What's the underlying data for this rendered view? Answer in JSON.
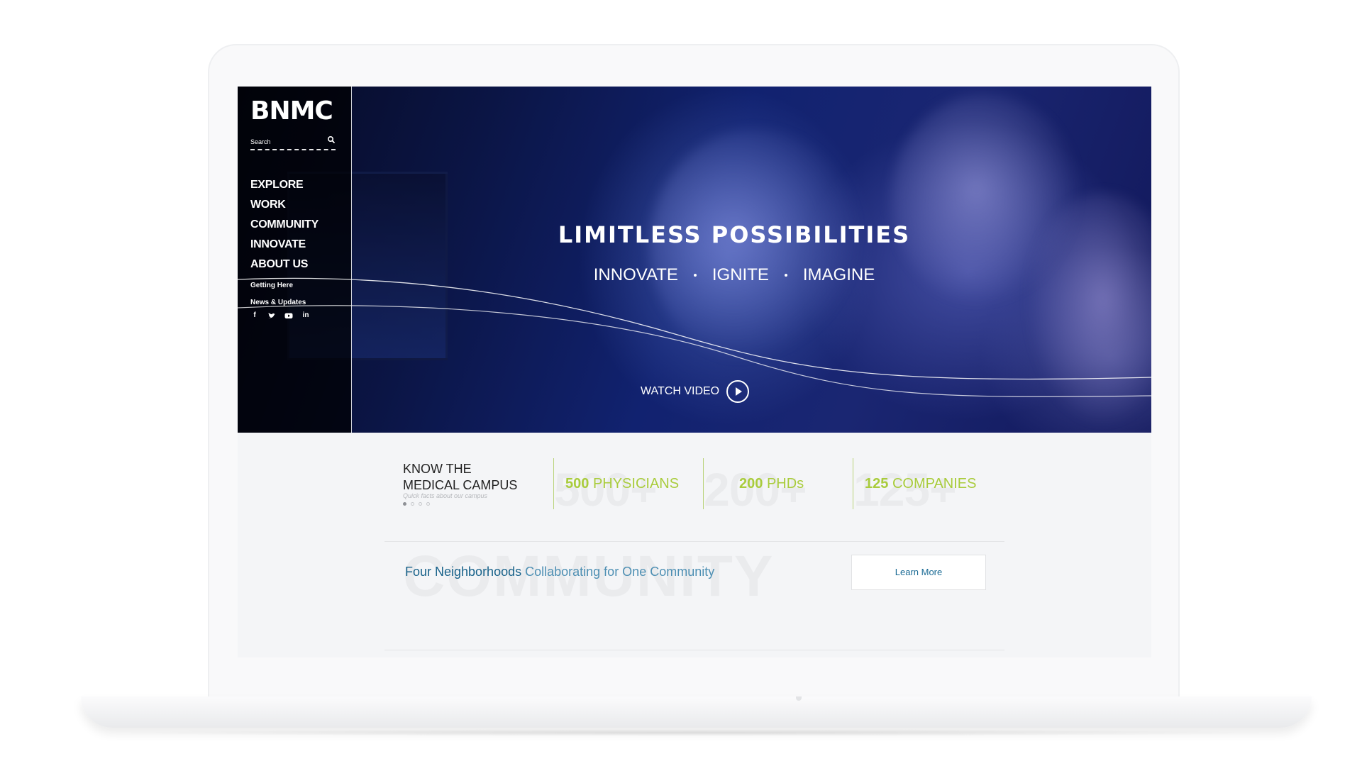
{
  "logo": "BNMC",
  "search": {
    "placeholder": "Search"
  },
  "nav": {
    "items": [
      "EXPLORE",
      "WORK",
      "COMMUNITY",
      "INNOVATE",
      "ABOUT US"
    ],
    "sub_items": [
      "Getting Here",
      "News & Updates"
    ],
    "social": [
      "facebook-icon",
      "twitter-icon",
      "youtube-icon",
      "linkedin-icon"
    ]
  },
  "hero": {
    "title": "LIMITLESS POSSIBILITIES",
    "tagline": [
      "INNOVATE",
      "IGNITE",
      "IMAGINE"
    ],
    "watch_video": "WATCH VIDEO"
  },
  "stats_section": {
    "heading_line1": "KNOW THE",
    "heading_line2": "MEDICAL CAMPUS",
    "subtitle": "Quick facts about our campus",
    "carousel_dots": 4,
    "active_dot": 0,
    "stats": [
      {
        "bg": "500+",
        "number": "500",
        "label": "PHYSICIANS"
      },
      {
        "bg": "200+",
        "number": "200",
        "label": "PHDs"
      },
      {
        "bg": "125+",
        "number": "125",
        "label": "COMPANIES"
      }
    ]
  },
  "community": {
    "bg_word": "COMMUNITY",
    "strong": "Four Neighborhoods",
    "rest": " Collaborating for One Community",
    "button": "Learn More"
  },
  "colors": {
    "accent_green": "#a9cc3c",
    "accent_blue": "#1d6e96",
    "hero_blue": "#112270"
  }
}
